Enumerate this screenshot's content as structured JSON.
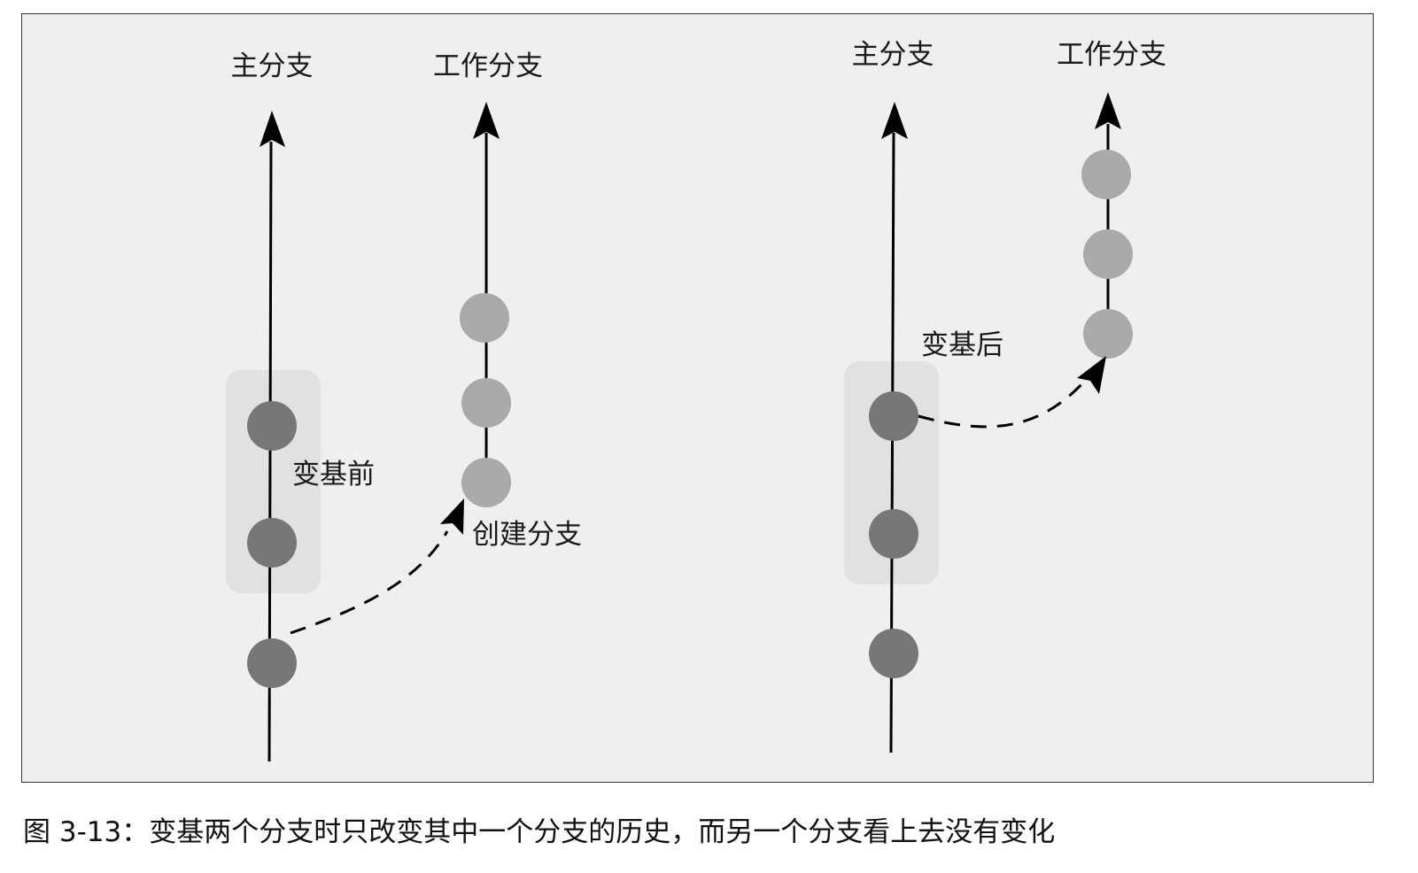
{
  "before": {
    "main_branch_label": "主分支",
    "work_branch_label": "工作分支",
    "group_label": "变基前",
    "create_branch_label": "创建分支"
  },
  "after": {
    "main_branch_label": "主分支",
    "work_branch_label": "工作分支",
    "group_label": "变基后"
  },
  "caption": "图 3-13：变基两个分支时只改变其中一个分支的历史，而另一个分支看上去没有变化",
  "colors": {
    "main_commit": "#777777",
    "work_commit": "#aaaaaa",
    "group_highlight": "#e1e1e1",
    "line": "#000000",
    "background": "#efefef"
  }
}
